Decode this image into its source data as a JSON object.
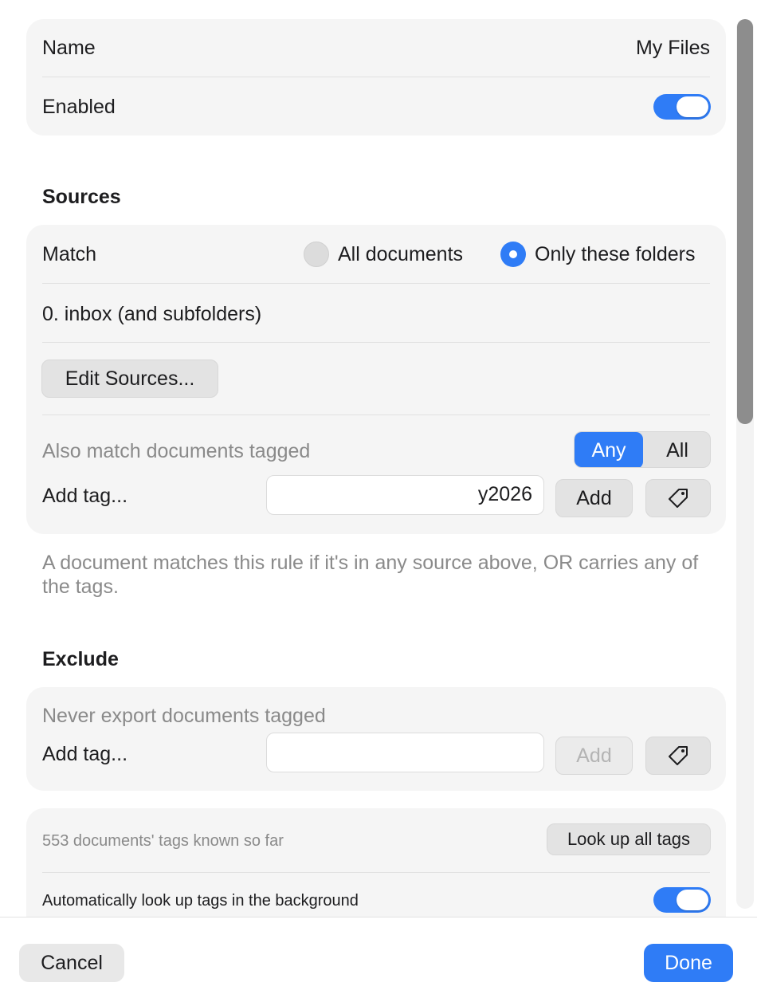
{
  "general": {
    "name_label": "Name",
    "name_value": "My Files",
    "enabled_label": "Enabled",
    "enabled": true
  },
  "sources": {
    "title": "Sources",
    "match_label": "Match",
    "option_all": "All documents",
    "option_folders": "Only these folders",
    "selected": "Only these folders",
    "folder_item": "0. inbox (and subfolders)",
    "edit_button": "Edit Sources...",
    "tagged_label": "Also match documents tagged",
    "seg_any": "Any",
    "seg_all": "All",
    "seg_selected": "Any",
    "add_tag_label": "Add tag...",
    "tag_input_value": "y2026",
    "add_button": "Add",
    "help_text": "A document matches this rule if it's in any source above, OR carries any of the tags."
  },
  "exclude": {
    "title": "Exclude",
    "never_label": "Never export documents tagged",
    "add_tag_label": "Add tag...",
    "tag_input_value": "",
    "add_button": "Add"
  },
  "tags_lookup": {
    "known_text": "553 documents' tags known so far",
    "lookup_button": "Look up all tags",
    "auto_label": "Automatically look up tags in the background",
    "auto_enabled": true
  },
  "footer": {
    "cancel": "Cancel",
    "done": "Done"
  },
  "colors": {
    "accent": "#2f7cf6",
    "card": "#f5f5f5"
  },
  "icons": {
    "tag": "tag-icon"
  }
}
